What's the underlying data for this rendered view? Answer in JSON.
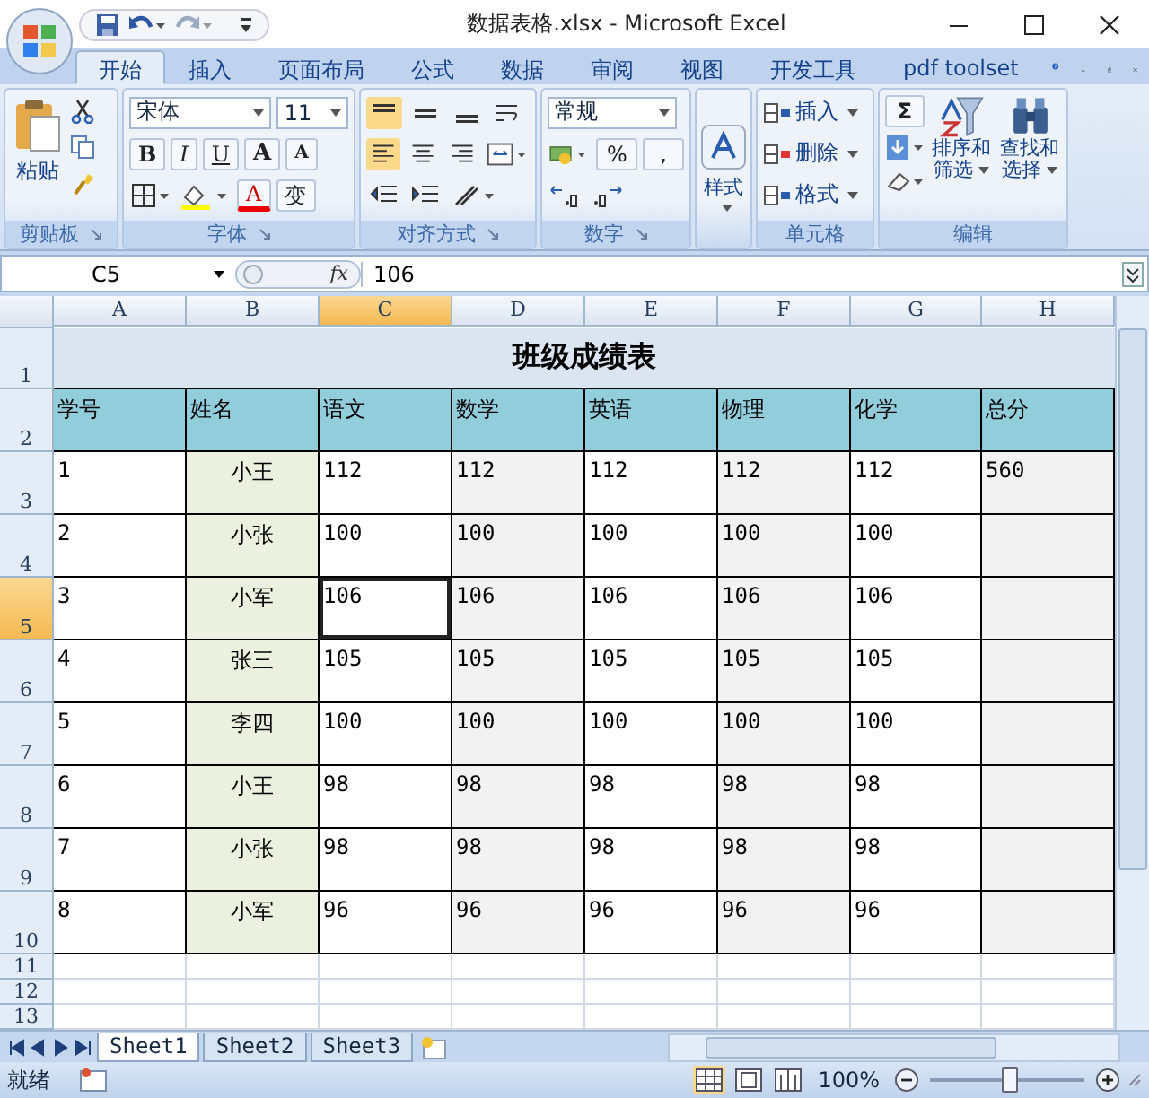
{
  "window": {
    "title": "数据表格.xlsx - Microsoft Excel"
  },
  "ribbon": {
    "tabs": [
      {
        "label": "开始",
        "selected": true
      },
      {
        "label": "插入",
        "selected": false
      },
      {
        "label": "页面布局",
        "selected": false
      },
      {
        "label": "公式",
        "selected": false
      },
      {
        "label": "数据",
        "selected": false
      },
      {
        "label": "审阅",
        "selected": false
      },
      {
        "label": "视图",
        "selected": false
      },
      {
        "label": "开发工具",
        "selected": false
      },
      {
        "label": "pdf toolset",
        "selected": false
      }
    ],
    "clipboard": {
      "label": "剪贴板",
      "paste": "粘贴"
    },
    "font": {
      "label": "字体",
      "font_name": "宋体",
      "font_size": "11",
      "style_buttons": [
        {
          "label": "B",
          "kind": "bold"
        },
        {
          "label": "I",
          "kind": "italic"
        },
        {
          "label": "U",
          "kind": "underline"
        }
      ],
      "grow": "A",
      "shrink": "A",
      "font_color": "A",
      "phonetic": "变"
    },
    "alignment": {
      "label": "对齐方式"
    },
    "number": {
      "label": "数字",
      "format": "常规",
      "percent": "%",
      "comma": ","
    },
    "styles": {
      "label": "样式"
    },
    "cells": {
      "label": "单元格",
      "items": [
        "插入",
        "删除",
        "格式"
      ]
    },
    "editing": {
      "label": "编辑",
      "sum": "Σ",
      "sort": [
        "排序和",
        "筛选"
      ],
      "find": [
        "查找和",
        "选择"
      ]
    }
  },
  "formula_bar": {
    "name_box": "C5",
    "fx": "fx",
    "formula": "106"
  },
  "sheet": {
    "columns": [
      {
        "label": "A",
        "selected": false,
        "color": "#ffffff"
      },
      {
        "label": "B",
        "selected": false,
        "color": "#ebf1de"
      },
      {
        "label": "C",
        "selected": true,
        "color": "#ffffff"
      },
      {
        "label": "D",
        "selected": false,
        "color": "#f2f2f2"
      },
      {
        "label": "E",
        "selected": false,
        "color": "#ffffff"
      },
      {
        "label": "F",
        "selected": false,
        "color": "#f2f2f2"
      },
      {
        "label": "G",
        "selected": false,
        "color": "#ffffff"
      },
      {
        "label": "H",
        "selected": false,
        "color": "#f2f2f2"
      }
    ],
    "rows": [
      {
        "number": "1",
        "selected": false,
        "kind": "title",
        "text": "班级成绩表"
      },
      {
        "number": "2",
        "selected": false,
        "kind": "header",
        "cells": [
          "学号",
          "姓名",
          "语文",
          "数学",
          "英语",
          "物理",
          "化学",
          "总分"
        ]
      },
      {
        "number": "3",
        "selected": false,
        "kind": "data",
        "cells": [
          "1",
          "小王",
          "112",
          "112",
          "112",
          "112",
          "112",
          "560"
        ]
      },
      {
        "number": "4",
        "selected": false,
        "kind": "data",
        "cells": [
          "2",
          "小张",
          "100",
          "100",
          "100",
          "100",
          "100"
        ]
      },
      {
        "number": "5",
        "selected": true,
        "kind": "data",
        "cells": [
          "3",
          "小军",
          "106",
          "106",
          "106",
          "106",
          "106"
        ]
      },
      {
        "number": "6",
        "selected": false,
        "kind": "data",
        "cells": [
          "4",
          "张三",
          "105",
          "105",
          "105",
          "105",
          "105"
        ]
      },
      {
        "number": "7",
        "selected": false,
        "kind": "data",
        "cells": [
          "5",
          "李四",
          "100",
          "100",
          "100",
          "100",
          "100"
        ]
      },
      {
        "number": "8",
        "selected": false,
        "kind": "data",
        "cells": [
          "6",
          "小王",
          "98",
          "98",
          "98",
          "98",
          "98"
        ]
      },
      {
        "number": "9",
        "selected": false,
        "kind": "data",
        "cells": [
          "7",
          "小张",
          "98",
          "98",
          "98",
          "98",
          "98"
        ]
      },
      {
        "number": "10",
        "selected": false,
        "kind": "data",
        "cells": [
          "8",
          "小军",
          "96",
          "96",
          "96",
          "96",
          "96"
        ]
      },
      {
        "number": "11",
        "selected": false,
        "kind": "empty"
      },
      {
        "number": "12",
        "selected": false,
        "kind": "empty"
      },
      {
        "number": "13",
        "selected": false,
        "kind": "empty"
      }
    ]
  },
  "sheet_tabs": [
    {
      "label": "Sheet1",
      "selected": true
    },
    {
      "label": "Sheet2",
      "selected": false
    },
    {
      "label": "Sheet3",
      "selected": false
    }
  ],
  "status_bar": {
    "status": "就绪",
    "views": [
      {
        "kind": "normal",
        "selected": true
      },
      {
        "kind": "layout",
        "selected": false
      },
      {
        "kind": "preview",
        "selected": false
      }
    ],
    "zoom": "100%",
    "zoom_slider": {
      "level": 0.5
    }
  }
}
